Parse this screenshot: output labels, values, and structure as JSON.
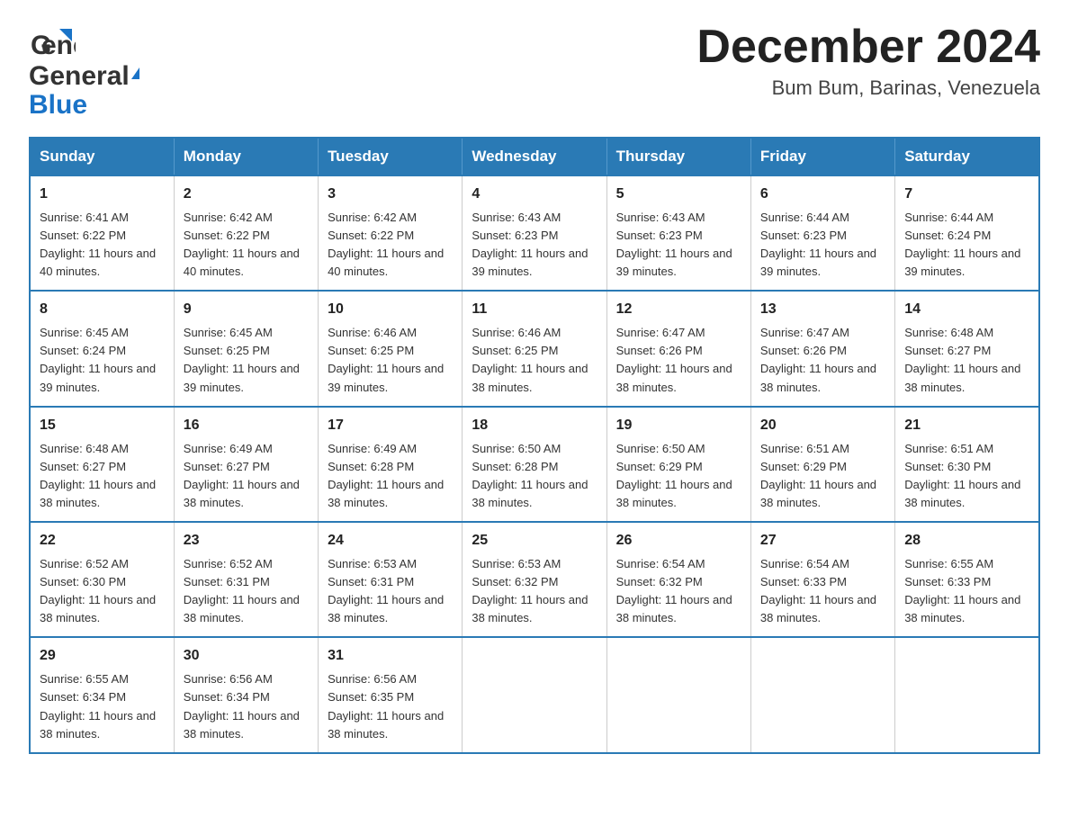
{
  "logo": {
    "text_general": "General",
    "text_blue": "Blue"
  },
  "header": {
    "title": "December 2024",
    "subtitle": "Bum Bum, Barinas, Venezuela"
  },
  "calendar": {
    "days_of_week": [
      "Sunday",
      "Monday",
      "Tuesday",
      "Wednesday",
      "Thursday",
      "Friday",
      "Saturday"
    ],
    "weeks": [
      [
        {
          "day": "1",
          "sunrise": "6:41 AM",
          "sunset": "6:22 PM",
          "daylight": "11 hours and 40 minutes."
        },
        {
          "day": "2",
          "sunrise": "6:42 AM",
          "sunset": "6:22 PM",
          "daylight": "11 hours and 40 minutes."
        },
        {
          "day": "3",
          "sunrise": "6:42 AM",
          "sunset": "6:22 PM",
          "daylight": "11 hours and 40 minutes."
        },
        {
          "day": "4",
          "sunrise": "6:43 AM",
          "sunset": "6:23 PM",
          "daylight": "11 hours and 39 minutes."
        },
        {
          "day": "5",
          "sunrise": "6:43 AM",
          "sunset": "6:23 PM",
          "daylight": "11 hours and 39 minutes."
        },
        {
          "day": "6",
          "sunrise": "6:44 AM",
          "sunset": "6:23 PM",
          "daylight": "11 hours and 39 minutes."
        },
        {
          "day": "7",
          "sunrise": "6:44 AM",
          "sunset": "6:24 PM",
          "daylight": "11 hours and 39 minutes."
        }
      ],
      [
        {
          "day": "8",
          "sunrise": "6:45 AM",
          "sunset": "6:24 PM",
          "daylight": "11 hours and 39 minutes."
        },
        {
          "day": "9",
          "sunrise": "6:45 AM",
          "sunset": "6:25 PM",
          "daylight": "11 hours and 39 minutes."
        },
        {
          "day": "10",
          "sunrise": "6:46 AM",
          "sunset": "6:25 PM",
          "daylight": "11 hours and 39 minutes."
        },
        {
          "day": "11",
          "sunrise": "6:46 AM",
          "sunset": "6:25 PM",
          "daylight": "11 hours and 38 minutes."
        },
        {
          "day": "12",
          "sunrise": "6:47 AM",
          "sunset": "6:26 PM",
          "daylight": "11 hours and 38 minutes."
        },
        {
          "day": "13",
          "sunrise": "6:47 AM",
          "sunset": "6:26 PM",
          "daylight": "11 hours and 38 minutes."
        },
        {
          "day": "14",
          "sunrise": "6:48 AM",
          "sunset": "6:27 PM",
          "daylight": "11 hours and 38 minutes."
        }
      ],
      [
        {
          "day": "15",
          "sunrise": "6:48 AM",
          "sunset": "6:27 PM",
          "daylight": "11 hours and 38 minutes."
        },
        {
          "day": "16",
          "sunrise": "6:49 AM",
          "sunset": "6:27 PM",
          "daylight": "11 hours and 38 minutes."
        },
        {
          "day": "17",
          "sunrise": "6:49 AM",
          "sunset": "6:28 PM",
          "daylight": "11 hours and 38 minutes."
        },
        {
          "day": "18",
          "sunrise": "6:50 AM",
          "sunset": "6:28 PM",
          "daylight": "11 hours and 38 minutes."
        },
        {
          "day": "19",
          "sunrise": "6:50 AM",
          "sunset": "6:29 PM",
          "daylight": "11 hours and 38 minutes."
        },
        {
          "day": "20",
          "sunrise": "6:51 AM",
          "sunset": "6:29 PM",
          "daylight": "11 hours and 38 minutes."
        },
        {
          "day": "21",
          "sunrise": "6:51 AM",
          "sunset": "6:30 PM",
          "daylight": "11 hours and 38 minutes."
        }
      ],
      [
        {
          "day": "22",
          "sunrise": "6:52 AM",
          "sunset": "6:30 PM",
          "daylight": "11 hours and 38 minutes."
        },
        {
          "day": "23",
          "sunrise": "6:52 AM",
          "sunset": "6:31 PM",
          "daylight": "11 hours and 38 minutes."
        },
        {
          "day": "24",
          "sunrise": "6:53 AM",
          "sunset": "6:31 PM",
          "daylight": "11 hours and 38 minutes."
        },
        {
          "day": "25",
          "sunrise": "6:53 AM",
          "sunset": "6:32 PM",
          "daylight": "11 hours and 38 minutes."
        },
        {
          "day": "26",
          "sunrise": "6:54 AM",
          "sunset": "6:32 PM",
          "daylight": "11 hours and 38 minutes."
        },
        {
          "day": "27",
          "sunrise": "6:54 AM",
          "sunset": "6:33 PM",
          "daylight": "11 hours and 38 minutes."
        },
        {
          "day": "28",
          "sunrise": "6:55 AM",
          "sunset": "6:33 PM",
          "daylight": "11 hours and 38 minutes."
        }
      ],
      [
        {
          "day": "29",
          "sunrise": "6:55 AM",
          "sunset": "6:34 PM",
          "daylight": "11 hours and 38 minutes."
        },
        {
          "day": "30",
          "sunrise": "6:56 AM",
          "sunset": "6:34 PM",
          "daylight": "11 hours and 38 minutes."
        },
        {
          "day": "31",
          "sunrise": "6:56 AM",
          "sunset": "6:35 PM",
          "daylight": "11 hours and 38 minutes."
        },
        null,
        null,
        null,
        null
      ]
    ]
  }
}
